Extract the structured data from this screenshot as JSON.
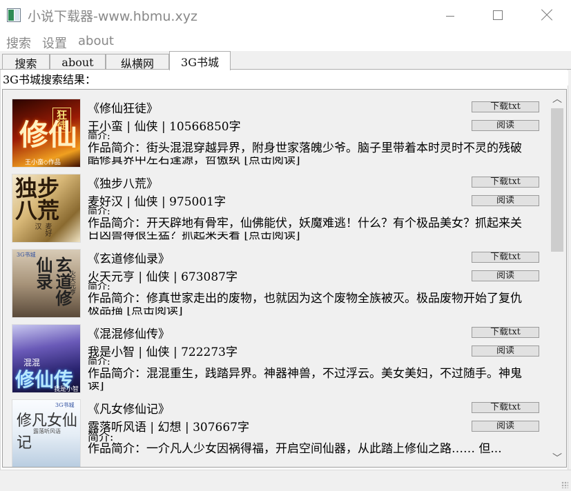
{
  "window": {
    "title": "小说下载器-www.hbmu.xyz"
  },
  "menu": {
    "items": [
      "搜索",
      "设置",
      "about"
    ]
  },
  "tabs": [
    {
      "label": "搜索"
    },
    {
      "label": "about"
    },
    {
      "label": "纵横网"
    },
    {
      "label": "3G书城"
    }
  ],
  "results": {
    "label": "3G书城搜索结果：",
    "download_label": "下载txt",
    "read_label": "阅读",
    "books": [
      {
        "title": "《修仙狂徒》",
        "meta": "王小蛮 | 仙侠 | 10566850字",
        "jj": "简介:",
        "desc": "作品简介：街头混混穿越异界，附身世家落魄少爷。脑子里带着本时灵时不灵的残破",
        "link": "酷修真界中左右逢源，哲傲纨     [点击阅读]",
        "cover_text": "王小蛮◇作品",
        "cover_bg": "#8b1a0a"
      },
      {
        "title": "《独步八荒》",
        "meta": "麦好汉 | 仙侠 | 975001字",
        "jj": "简介:",
        "desc": "作品简介：开天辟地有骨牢，仙佛能伏，妖魔难逃！什么？有个极品美女？抓起来关",
        "link": "日凶兽得很生猛？抓起来关着    [点击阅读]",
        "cover_text": "麦好汉",
        "cover_bg": "#c9a65a"
      },
      {
        "title": "《玄道修仙录》",
        "meta": "火天元亨 | 仙侠 | 673087字",
        "jj": "简介:",
        "desc": "作品简介：修真世家走出的废物，也就因为这个废物全族被灭。极品废物开始了复仇",
        "link": "极品描   [点击阅读]",
        "cover_text": "火天元亨",
        "cover_bg": "#b8a38a"
      },
      {
        "title": "《混混修仙传》",
        "meta": "我是小智 | 仙侠 | 722273字",
        "jj": "简介:",
        "desc": "作品简介：混混重生，践踏异界。神器神兽，不过浮云。美女美妇，不过随手。神鬼",
        "link": "读]",
        "cover_text": "我是小智",
        "cover_bg": "#3a3a8a"
      },
      {
        "title": "《凡女修仙记》",
        "meta": "露落听风语 | 幻想 | 307667字",
        "jj": "简介:",
        "desc": "作品简介：一介凡人少女因祸得福，开启空间仙器，从此踏上修仙之路……  但...",
        "link": "",
        "cover_text": "露落听风语",
        "cover_bg": "#dde8f0"
      }
    ]
  }
}
